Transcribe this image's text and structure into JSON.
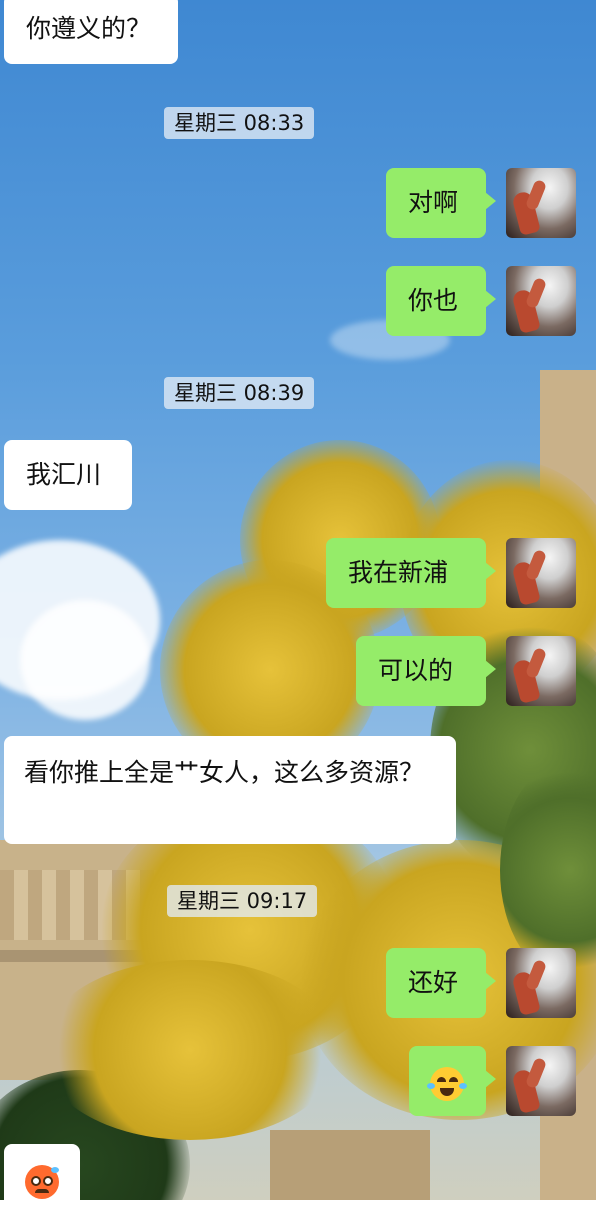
{
  "chat": {
    "messages": [
      {
        "side": "in",
        "text": "你遵义的？"
      },
      {
        "type": "time",
        "text": "星期三 08:33"
      },
      {
        "side": "out",
        "text": "对啊"
      },
      {
        "side": "out",
        "text": "你也"
      },
      {
        "type": "time",
        "text": "星期三 08:39"
      },
      {
        "side": "in",
        "text": "我汇川"
      },
      {
        "side": "out",
        "text": "我在新浦"
      },
      {
        "side": "out",
        "text": "可以的"
      },
      {
        "side": "in",
        "text": "看你推上全是艹女人，这么多资源？"
      },
      {
        "type": "time",
        "text": "星期三 09:17"
      },
      {
        "side": "out",
        "text": "还好"
      },
      {
        "side": "out",
        "emoji": "face-with-tears-of-joy"
      },
      {
        "side": "in",
        "emoji": "anxious-face"
      }
    ]
  },
  "colors": {
    "outgoing_bubble": "#95ec69",
    "incoming_bubble": "#ffffff"
  }
}
